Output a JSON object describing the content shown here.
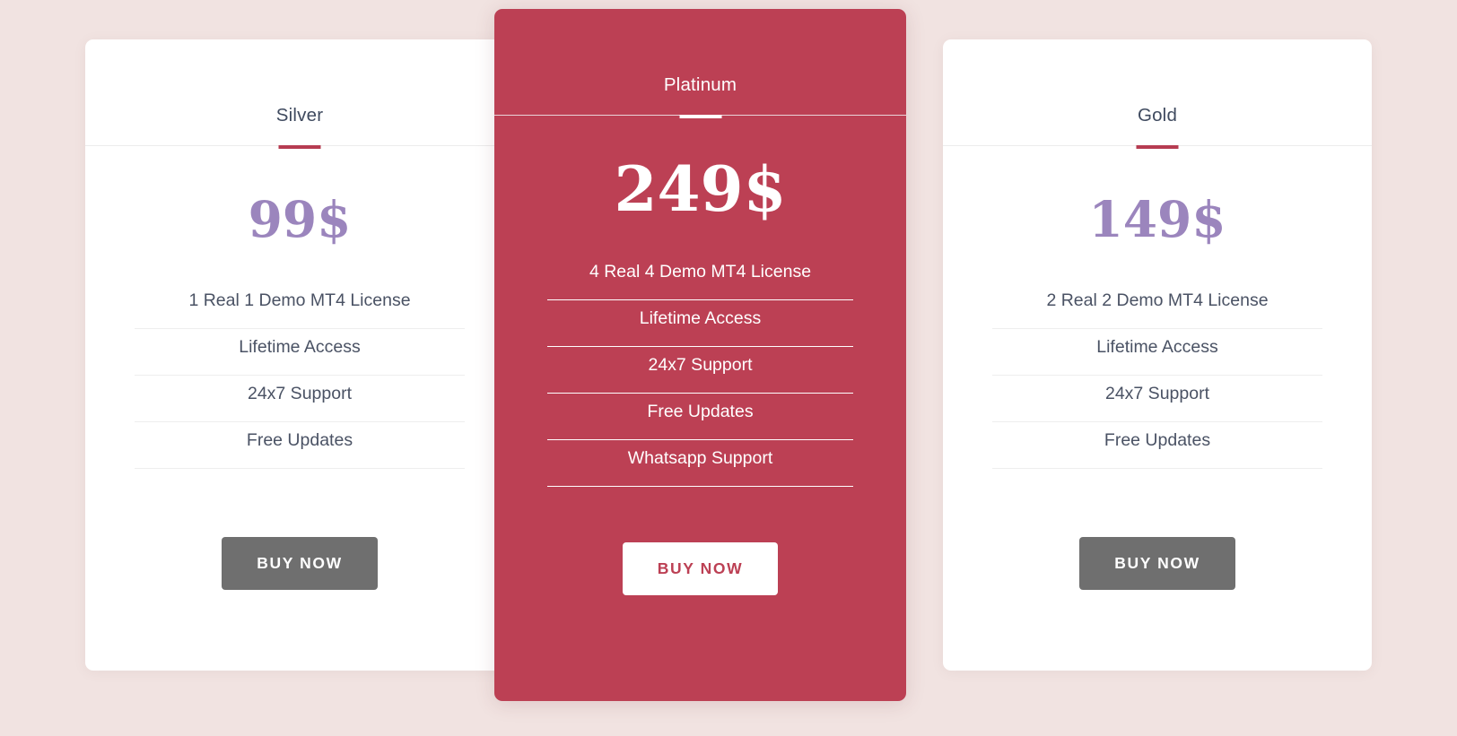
{
  "page": {
    "background_color": "#f1e3e1",
    "accent_color": "#bc4054",
    "price_color": "#9b85bd",
    "side_button_color": "#6f6f6f"
  },
  "plans": [
    {
      "id": "silver",
      "name": "Silver",
      "price": "99$",
      "featured": false,
      "features": [
        "1 Real 1 Demo MT4 License",
        "Lifetime Access",
        "24x7 Support",
        "Free Updates"
      ],
      "cta": "BUY NOW"
    },
    {
      "id": "platinum",
      "name": "Platinum",
      "price": "249$",
      "featured": true,
      "features": [
        "4 Real 4 Demo MT4 License",
        "Lifetime Access",
        "24x7 Support",
        "Free Updates",
        "Whatsapp Support"
      ],
      "cta": "BUY NOW"
    },
    {
      "id": "gold",
      "name": "Gold",
      "price": "149$",
      "featured": false,
      "features": [
        "2 Real 2 Demo MT4 License",
        "Lifetime Access",
        "24x7 Support",
        "Free Updates"
      ],
      "cta": "BUY NOW"
    }
  ]
}
